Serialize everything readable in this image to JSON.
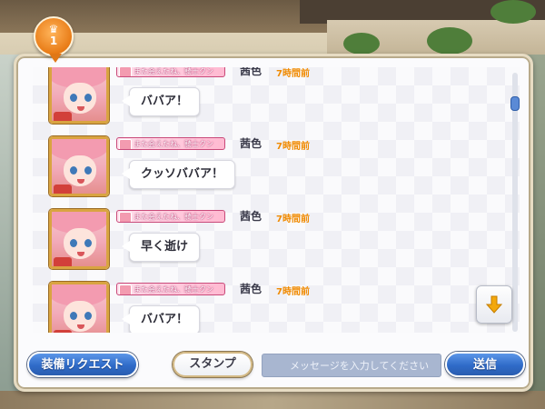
{
  "clan_badge": {
    "number": "1",
    "crest": "♛"
  },
  "messages": [
    {
      "title": "また会えたね、騎士クン",
      "sender": "茜色",
      "time": "7時間前",
      "text": "ババア！"
    },
    {
      "title": "また会えたね、騎士クン",
      "sender": "茜色",
      "time": "7時間前",
      "text": "クッソババア！"
    },
    {
      "title": "また会えたね、騎士クン",
      "sender": "茜色",
      "time": "7時間前",
      "text": "早く逝け"
    },
    {
      "title": "また会えたね、騎士クン",
      "sender": "茜色",
      "time": "7時間前",
      "text": "ババア！"
    }
  ],
  "bottom_bar": {
    "equip_request_label": "装備リクエスト",
    "stamp_label": "スタンプ",
    "message_placeholder": "メッセージを入力してください",
    "send_label": "送信"
  },
  "icons": {
    "scroll_down": "arrow-down-icon"
  },
  "colors": {
    "accent_orange": "#f08a00",
    "button_blue": "#2f6bc8",
    "input_bg": "#a8b6d0"
  }
}
